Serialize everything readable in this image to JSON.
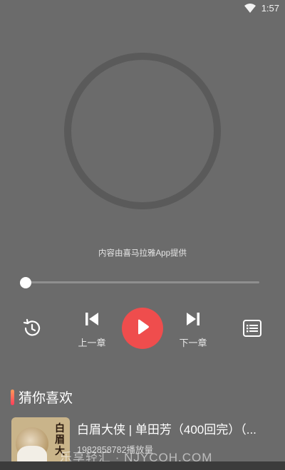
{
  "status_bar": {
    "time": "1:57",
    "wifi_icon": "wifi-icon"
  },
  "player": {
    "provider_text": "内容由喜马拉雅App提供",
    "progress": 0,
    "controls": {
      "history_icon": "history-icon",
      "prev_label": "上一章",
      "play_icon": "play-icon",
      "next_label": "下一章",
      "playlist_icon": "playlist-icon"
    }
  },
  "recommend": {
    "title": "猜你喜欢",
    "items": [
      {
        "name": "白眉大侠 | 单田芳（400回完）（...",
        "plays": "1982858782播放量",
        "cover_text": "白眉大"
      }
    ]
  },
  "watermark": "乐享轻汇 · NJYCQH.COM",
  "colors": {
    "background": "#6b6b6b",
    "accent": "#ef4d4d",
    "ring": "#5a5a5a"
  }
}
